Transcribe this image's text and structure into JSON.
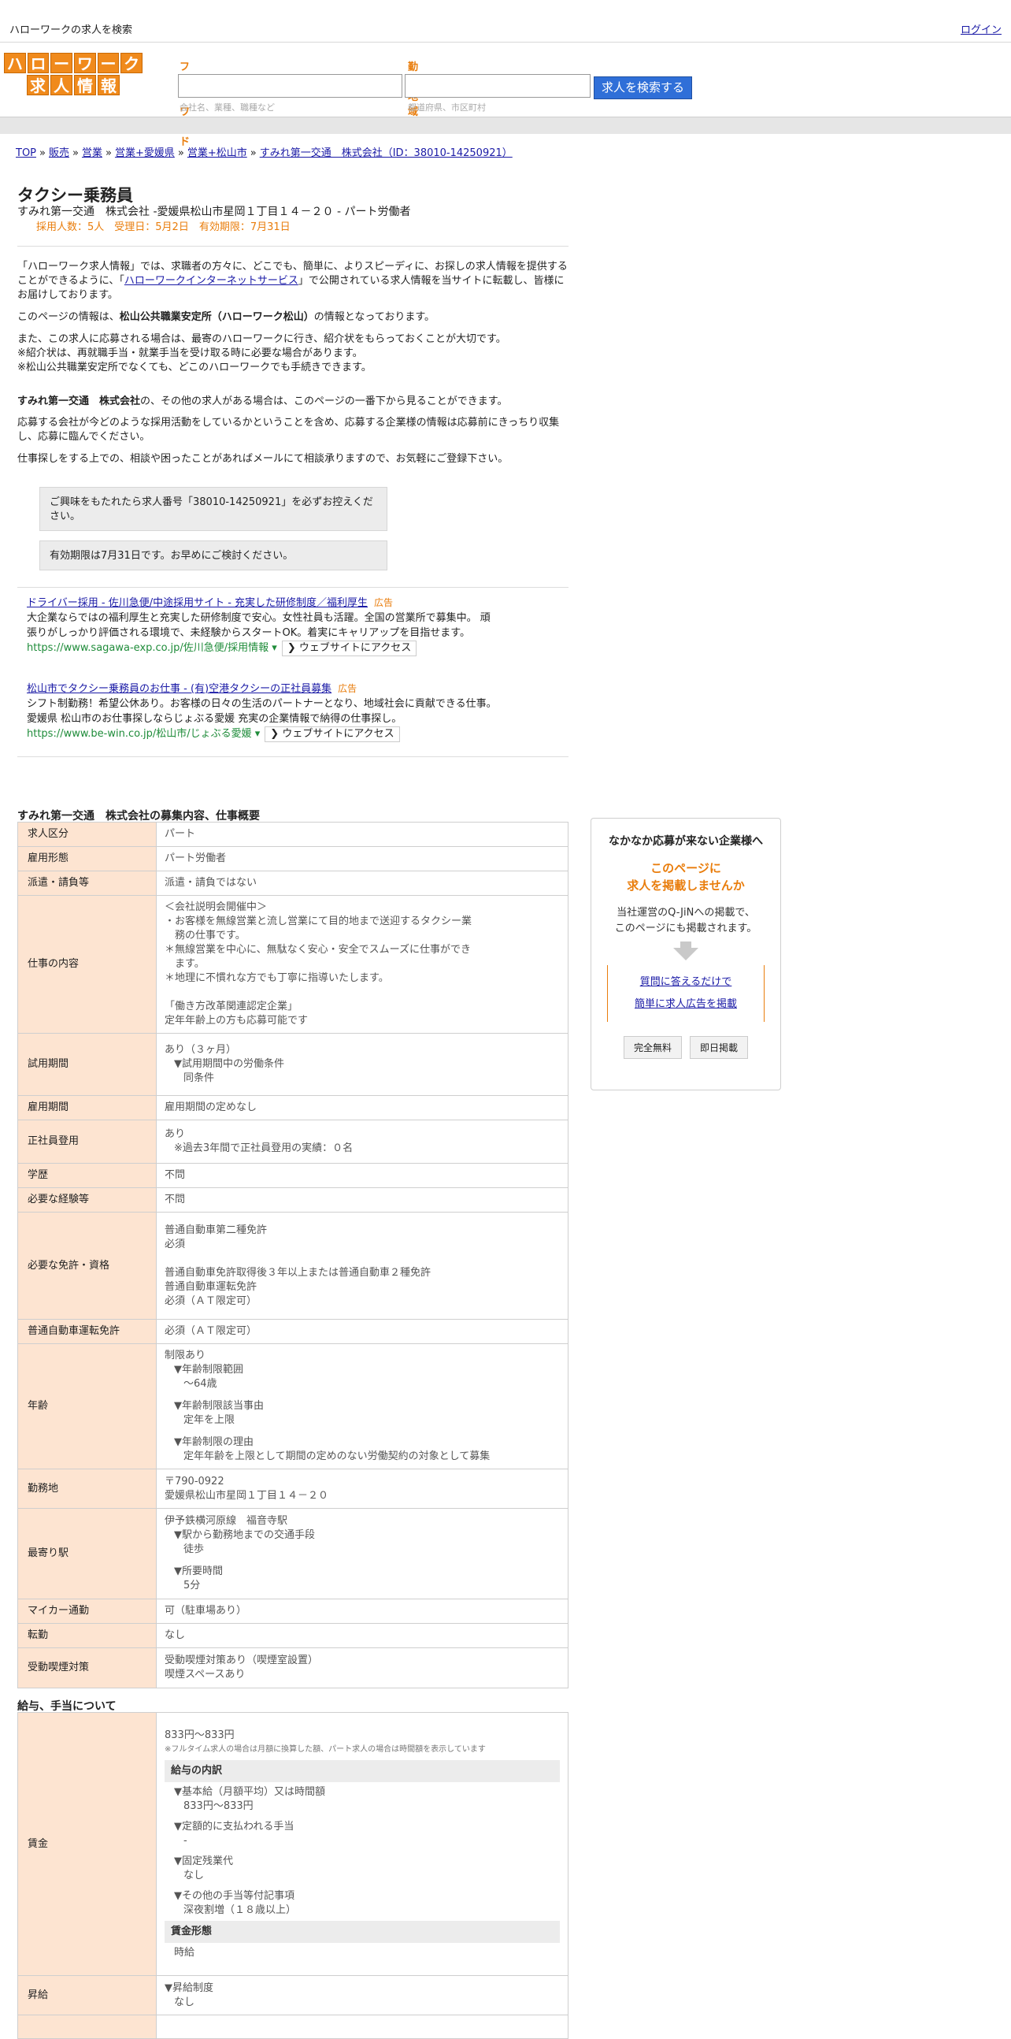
{
  "topbar": {
    "site_name": "ハローワークの求人を検索",
    "login": "ログイン"
  },
  "logo": {
    "row1": [
      "ハ",
      "ロ",
      "ー",
      "ワ",
      "ー",
      "ク"
    ],
    "row2": [
      "求",
      "人",
      "情",
      "報"
    ]
  },
  "search": {
    "freeword_label": "フリーワード",
    "freeword_hint": "会社名、業種、職種など",
    "area_label": "勤務地域",
    "area_hint": "都道府県、市区町村",
    "button": "求人を検索する"
  },
  "breadcrumb": [
    "TOP",
    "販売",
    "営業",
    "営業+愛媛県",
    "営業+松山市",
    "すみれ第一交通　株式会社（ID：38010-14250921）"
  ],
  "job": {
    "title": "タクシー乗務員",
    "subtitle": "すみれ第一交通　株式会社 -愛媛県松山市星岡１丁目１４－２０ - パート労働者",
    "meta": "採用人数：5人　受理日：5月2日　有効期限：7月31日"
  },
  "intro": {
    "p1_a": "「ハローワーク求人情報」では、求職者の方々に、どこでも、簡単に、よりスピーディに、お探しの求人情報を提供することができるように、「",
    "p1_link": "ハローワークインターネットサービス",
    "p1_b": "」で公開されている求人情報を当サイトに転載し、皆様にお届けしております。",
    "p2_a": "このページの情報は、",
    "p2_bold": "松山公共職業安定所（ハローワーク松山）",
    "p2_b": "の情報となっております。",
    "p3_l1": "また、この求人に応募される場合は、最寄のハローワークに行き、紹介状をもらっておくことが大切です。",
    "p3_l2": "※紹介状は、再就職手当・就業手当を受け取る時に必要な場合があります。",
    "p3_l3": "※松山公共職業安定所でなくても、どこのハローワークでも手続きできます。",
    "p4_bold": "すみれ第一交通　株式会社",
    "p4_rest": "の、その他の求人がある場合は、このページの一番下から見ることができます。",
    "p5": "応募する会社が今どのような採用活動をしているかということを含め、応募する企業様の情報は応募前にきっちり収集し、応募に臨んでください。",
    "p6": "仕事探しをする上での、相談や困ったことがあればメールにて相談承りますので、お気軽にご登録下さい。"
  },
  "notices": {
    "n1": "ご興味をもたれたら求人番号「38010-14250921」を必ずお控えください。",
    "n2": "有効期限は7月31日です。お早めにご検討ください。"
  },
  "ads": [
    {
      "title": "ドライバー採用 - 佐川急便/中途採用サイト - 充実した研修制度／福利厚生",
      "tag": "広告",
      "desc_l1": "大企業ならではの福利厚生と充実した研修制度で安心。女性社員も活躍。全国の営業所で募集中。 頑",
      "desc_l2": "張りがしっかり評価される環境で、未経験からスタートOK。着実にキャリアップを目指せます。",
      "url": "https://www.sagawa-exp.co.jp/佐川急便/採用情報",
      "visit": "ウェブサイトにアクセス"
    },
    {
      "title": "松山市でタクシー乗務員のお仕事 - (有)空港タクシーの正社員募集",
      "tag": "広告",
      "desc_l1": "シフト制勤務！希望公休あり。お客様の日々の生活のパートナーとなり、地域社会に貢献できる仕事。",
      "desc_l2": "愛媛県 松山市のお仕事探しならじょぶる愛媛 充実の企業情報で納得の仕事探し。",
      "url": "https://www.be-win.co.jp/松山市/じょぶる愛媛",
      "visit": "ウェブサイトにアクセス"
    }
  ],
  "section1": {
    "title": "すみれ第一交通　株式会社の募集内容、仕事概要",
    "rows": {
      "kubun": {
        "label": "求人区分",
        "value": "パート"
      },
      "keitai": {
        "label": "雇用形態",
        "value": "パート労働者"
      },
      "haken": {
        "label": "派遣・請負等",
        "value": "派遣・請負ではない"
      },
      "naiyo": {
        "label": "仕事の内容",
        "lines": [
          "＜会社説明会開催中＞",
          "・お客様を無線営業と流し営業にて目的地まで送迎するタクシー業",
          "　務の仕事です。",
          "＊無線営業を中心に、無駄なく安心・安全でスムーズに仕事ができ",
          "　ます。",
          "＊地理に不慣れな方でも丁寧に指導いたします。",
          "",
          "「働き方改革関連認定企業」",
          "定年年齢上の方も応募可能です"
        ]
      },
      "shiyo": {
        "label": "試用期間",
        "l1": "あり（３ヶ月）",
        "l2": "▼試用期間中の労働条件",
        "l3": "同条件"
      },
      "koyokikan": {
        "label": "雇用期間",
        "value": "雇用期間の定めなし"
      },
      "seishain": {
        "label": "正社員登用",
        "l1": "あり",
        "l2": "※過去3年間で正社員登用の実績：０名"
      },
      "gakureki": {
        "label": "学歴",
        "value": "不問"
      },
      "keiken": {
        "label": "必要な経験等",
        "value": "不問"
      },
      "menkyo": {
        "label": "必要な免許・資格",
        "lines": [
          "普通自動車第二種免許",
          "必須",
          "",
          "普通自動車免許取得後３年以上または普通自動車２種免許",
          "普通自動車運転免許",
          "必須（ＡＴ限定可）"
        ]
      },
      "unten": {
        "label": "普通自動車運転免許",
        "value": "必須（ＡＴ限定可）"
      },
      "nenrei": {
        "label": "年齢",
        "l1": "制限あり",
        "l2": "▼年齢制限範囲",
        "l3": "〜64歳",
        "l4": "▼年齢制限該当事由",
        "l5": "定年を上限",
        "l6": "▼年齢制限の理由",
        "l7": "定年年齢を上限として期間の定めのない労働契約の対象として募集"
      },
      "kinmuchi": {
        "label": "勤務地",
        "l1": "〒790-0922",
        "l2": "愛媛県松山市星岡１丁目１４－２０"
      },
      "eki": {
        "label": "最寄り駅",
        "l1": "伊予鉄横河原線　福音寺駅",
        "l2": "▼駅から勤務地までの交通手段",
        "l3": "徒歩",
        "l4": "▼所要時間",
        "l5": "5分"
      },
      "mycar": {
        "label": "マイカー通勤",
        "value": "可（駐車場あり）"
      },
      "tenkin": {
        "label": "転勤",
        "value": "なし"
      },
      "kitsuen": {
        "label": "受動喫煙対策",
        "l1": "受動喫煙対策あり（喫煙室設置）",
        "l2": "喫煙スペースあり"
      }
    }
  },
  "section2": {
    "title": "給与、手当について",
    "chingin": {
      "label": "賃金",
      "l1": "833円〜833円",
      "l2": "※フルタイム求人の場合は月額に換算した額、パート求人の場合は時間額を表示しています",
      "box1": "給与の内訳",
      "k1": "▼基本給（月額平均）又は時間額",
      "k1v": "833円〜833円",
      "k2": "▼定額的に支払われる手当",
      "k2v": "-",
      "k3": "▼固定残業代",
      "k3v": "なし",
      "k4": "▼その他の手当等付記事項",
      "k4v": "深夜割増（１８歳以上）",
      "box2": "賃金形態",
      "keitai": "時給"
    },
    "shokyu": {
      "label": "昇給",
      "l1": "▼昇給制度",
      "l2": "なし"
    }
  },
  "sidebox": {
    "heading": "なかなか応募が来ない企業様へ",
    "orange_l1": "このページに",
    "orange_l2": "求人を掲載しませんか",
    "text_l1": "当社運営のQ-JiNへの掲載で、",
    "text_l2": "このページにも掲載されます。",
    "link1": "質問に答えるだけで",
    "link2": "簡単に求人広告を掲載",
    "btn1": "完全無料",
    "btn2": "即日掲載"
  }
}
